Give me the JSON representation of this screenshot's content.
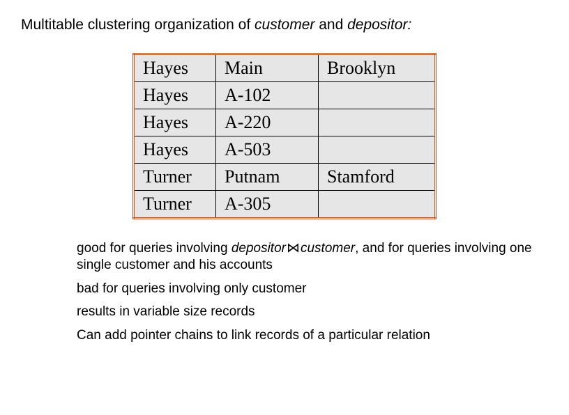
{
  "heading": {
    "prefix": "Multitable clustering organization of ",
    "italic1": "customer",
    "mid": " and ",
    "italic2": "depositor:",
    "suffix": ""
  },
  "table": {
    "rows": [
      {
        "c1": "Hayes",
        "c2": "Main",
        "c3": "Brooklyn"
      },
      {
        "c1": "Hayes",
        "c2": "A-102",
        "c3": ""
      },
      {
        "c1": "Hayes",
        "c2": "A-220",
        "c3": ""
      },
      {
        "c1": "Hayes",
        "c2": "A-503",
        "c3": ""
      },
      {
        "c1": "Turner",
        "c2": "Putnam",
        "c3": "Stamford"
      },
      {
        "c1": "Turner",
        "c2": "A-305",
        "c3": ""
      }
    ]
  },
  "notes": {
    "n1_prefix": "good for queries involving ",
    "n1_italic1": "depositor",
    "n1_join": "⋈",
    "n1_italic2": "customer",
    "n1_suffix": ", and for queries involving one single customer and his accounts",
    "n2": "bad for queries involving only customer",
    "n3": "results in variable size records",
    "n4": "Can add pointer chains to link records of a particular relation"
  }
}
